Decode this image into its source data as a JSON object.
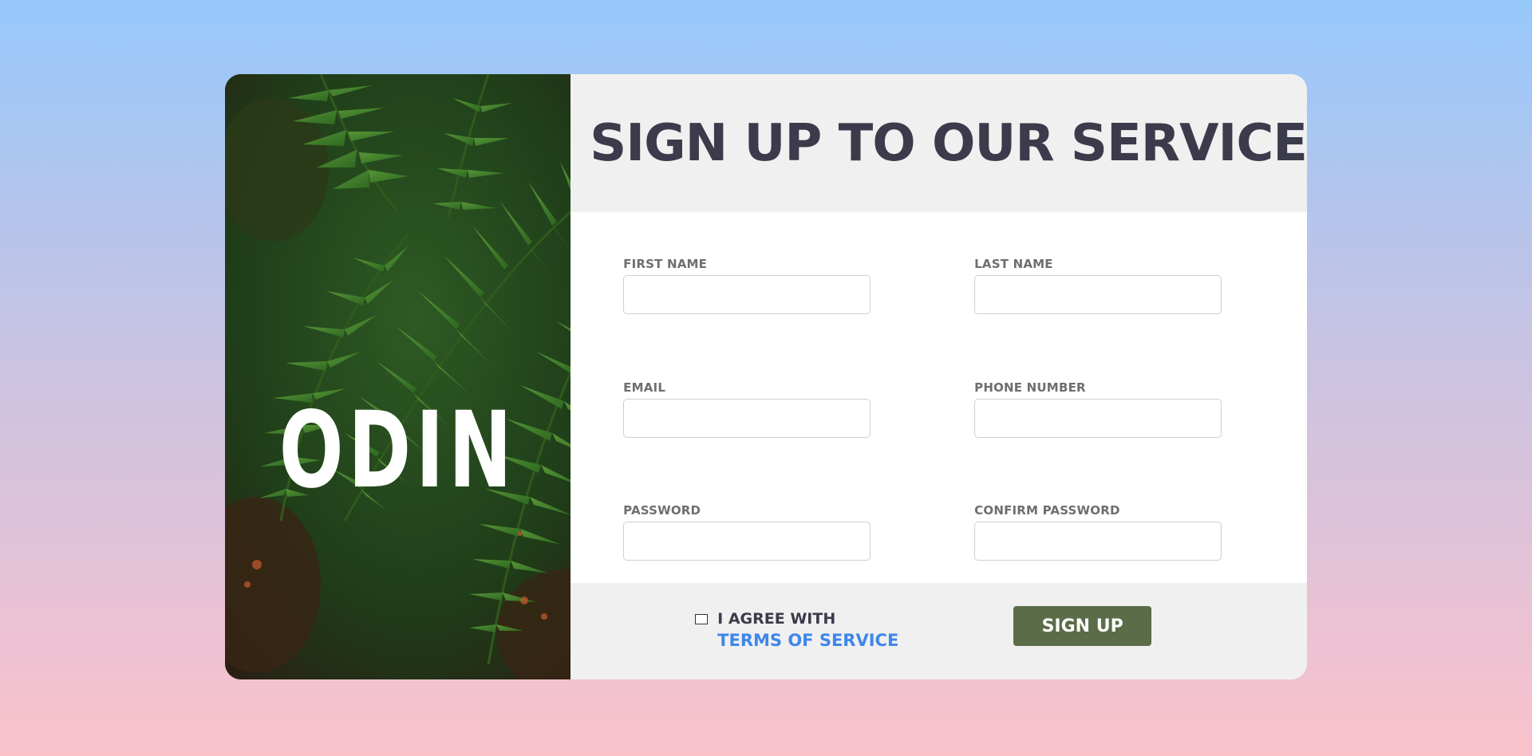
{
  "hero": {
    "logo_text": "ODIN",
    "background": "fern-leaves-photo"
  },
  "header": {
    "title": "SIGN UP TO OUR SERVICE"
  },
  "form": {
    "first_name": {
      "label": "FIRST NAME",
      "value": ""
    },
    "last_name": {
      "label": "LAST NAME",
      "value": ""
    },
    "email": {
      "label": "EMAIL",
      "value": ""
    },
    "phone": {
      "label": "PHONE NUMBER",
      "value": ""
    },
    "password": {
      "label": "PASSWORD",
      "value": ""
    },
    "confirm_password": {
      "label": "CONFIRM PASSWORD",
      "value": ""
    }
  },
  "footer": {
    "agree_text": "I AGREE WITH",
    "terms_link": "TERMS OF SERVICE",
    "checkbox_checked": false,
    "signup_label": "SIGN UP"
  },
  "colors": {
    "accent_button": "#5a6c48",
    "link": "#3f86ea",
    "title": "#3b3b4b"
  }
}
